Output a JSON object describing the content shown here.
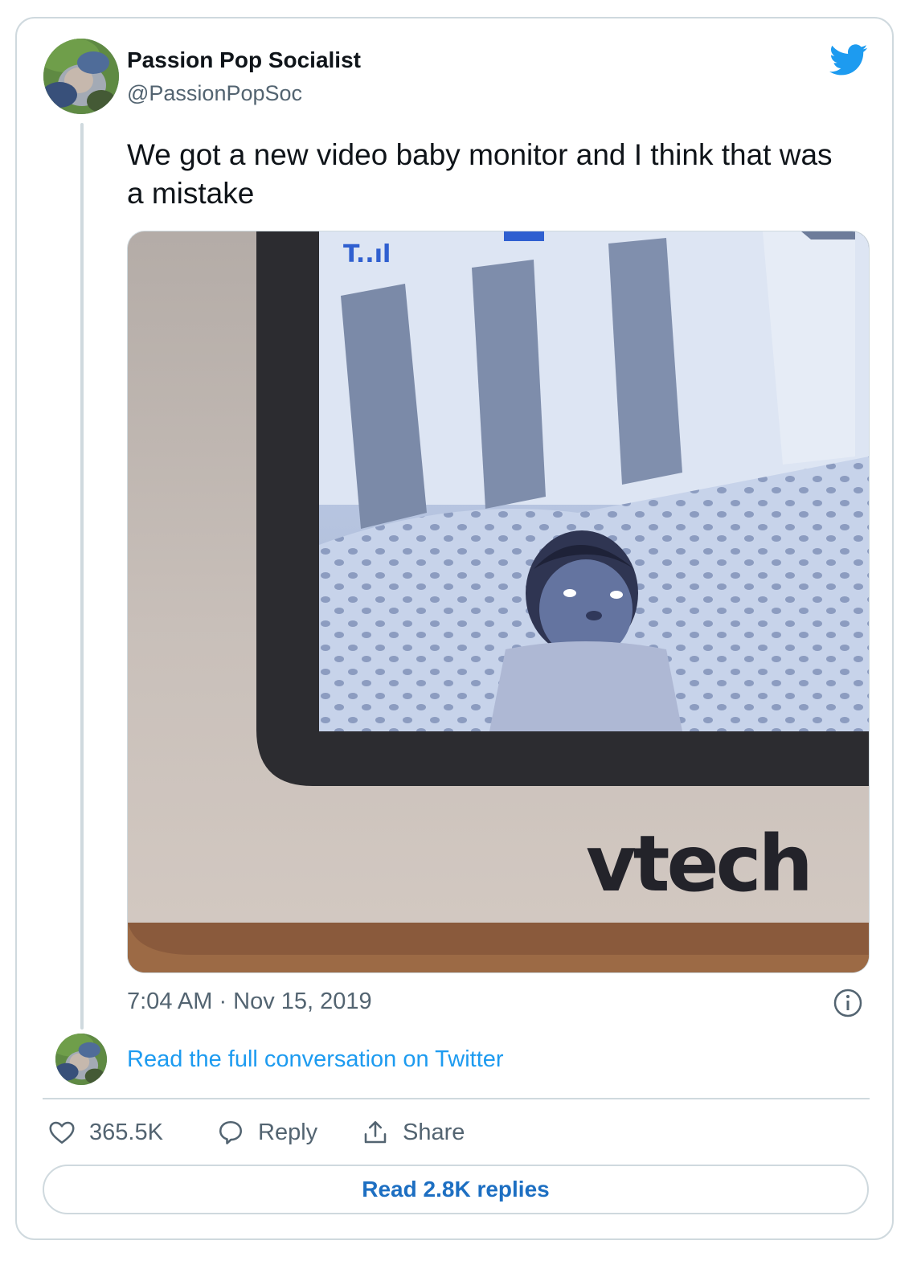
{
  "author": {
    "display_name": "Passion Pop Socialist",
    "handle": "@PassionPopSoc",
    "avatar_icon": "avatar-photo"
  },
  "platform_icon": "twitter-bird-icon",
  "tweet": {
    "text": "We got a new video baby monitor and I think that was a mistake",
    "media": {
      "monitor_signal_text": "T..ıl",
      "brand_text": "vtech"
    },
    "timestamp": "7:04 AM · Nov 15, 2019"
  },
  "conversation_link": "Read the full conversation on Twitter",
  "actions": {
    "like_count": "365.5K",
    "reply_label": "Reply",
    "share_label": "Share"
  },
  "replies_button": "Read 2.8K replies",
  "colors": {
    "accent": "#1d9bf0",
    "text_primary": "#0f1419",
    "text_secondary": "#536471",
    "border": "#cfd9de"
  }
}
